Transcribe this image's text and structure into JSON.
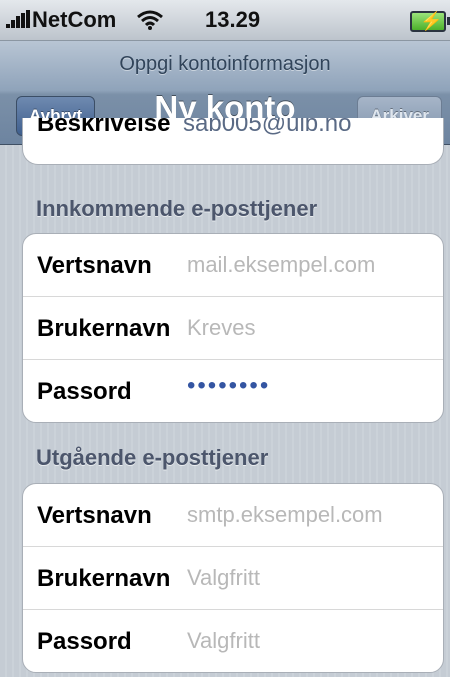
{
  "statusbar": {
    "carrier": "NetCom",
    "time": "13.29"
  },
  "navbar": {
    "prompt": "Oppgi kontoinformasjon",
    "title": "Ny konto",
    "cancel_label": "Avbryt",
    "save_label": "Arkiver"
  },
  "cutoff_row": {
    "label": "Beskrivelse",
    "value": "sab005@uib.no"
  },
  "incoming": {
    "header": "Innkommende e-posttjener",
    "host": {
      "label": "Vertsnavn",
      "placeholder": "mail.eksempel.com"
    },
    "username": {
      "label": "Brukernavn",
      "placeholder": "Kreves"
    },
    "password": {
      "label": "Passord",
      "masked": "••••••••"
    }
  },
  "outgoing": {
    "header": "Utgående e-posttjener",
    "host": {
      "label": "Vertsnavn",
      "placeholder": "smtp.eksempel.com"
    },
    "username": {
      "label": "Brukernavn",
      "placeholder": "Valgfritt"
    },
    "password": {
      "label": "Passord",
      "placeholder": "Valgfritt"
    }
  },
  "colors": {
    "nav_button": "#4a6a96",
    "password_dots": "#3455a2",
    "placeholder": "#b8b8b8",
    "section_header": "#4c566c"
  }
}
